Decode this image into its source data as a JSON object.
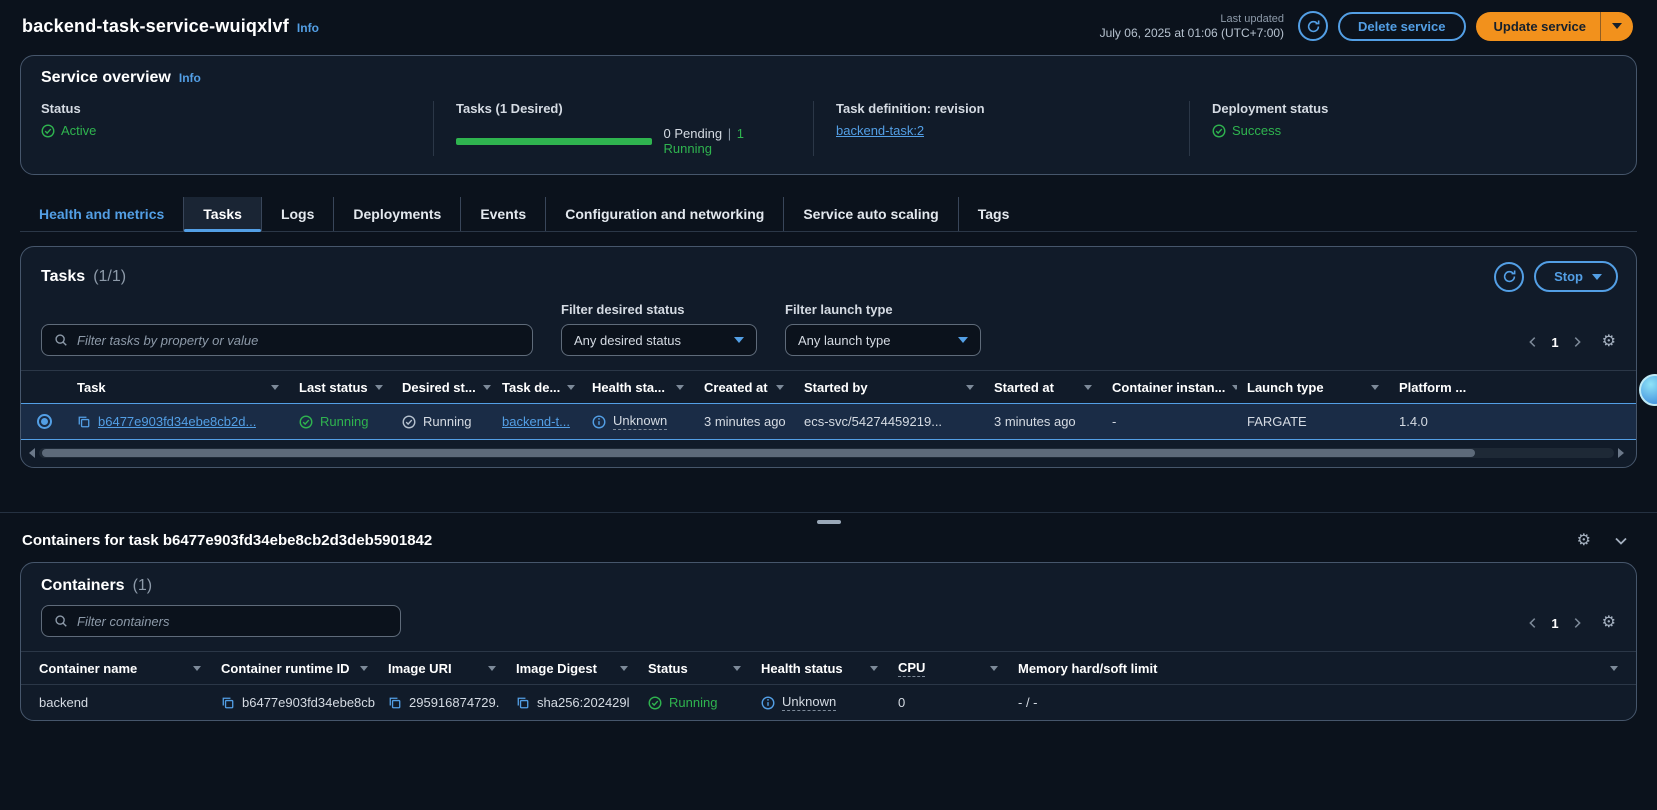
{
  "page": {
    "title": "backend-task-service-wuiqxlvf",
    "info": "Info",
    "last_updated_label": "Last updated",
    "last_updated_value": "July 06, 2025 at 01:06 (UTC+7:00)",
    "delete_service": "Delete service",
    "update_service": "Update service"
  },
  "overview": {
    "title": "Service overview",
    "info": "Info",
    "status": {
      "label": "Status",
      "value": "Active"
    },
    "tasks": {
      "label": "Tasks (1 Desired)",
      "pending": "0 Pending",
      "separator": "|",
      "running": "1 Running",
      "progress_percent": 100
    },
    "task_definition": {
      "label": "Task definition: revision",
      "value": "backend-task:2"
    },
    "deployment": {
      "label": "Deployment status",
      "value": "Success"
    }
  },
  "tabs": [
    {
      "label": "Health and metrics"
    },
    {
      "label": "Tasks"
    },
    {
      "label": "Logs"
    },
    {
      "label": "Deployments"
    },
    {
      "label": "Events"
    },
    {
      "label": "Configuration and networking"
    },
    {
      "label": "Service auto scaling"
    },
    {
      "label": "Tags"
    }
  ],
  "tasks_panel": {
    "title": "Tasks",
    "count": "(1/1)",
    "stop_button": "Stop",
    "filter_placeholder": "Filter tasks by property or value",
    "desired_status_filter": {
      "label": "Filter desired status",
      "value": "Any desired status"
    },
    "launch_type_filter": {
      "label": "Filter launch type",
      "value": "Any launch type"
    },
    "pagination": {
      "page": "1"
    },
    "columns": [
      "Task",
      "Last status",
      "Desired st...",
      "Task de...",
      "Health sta...",
      "Created at",
      "Started by",
      "Started at",
      "Container instan...",
      "Launch type",
      "Platform ..."
    ],
    "row": {
      "task_id": "b6477e903fd34ebe8cb2d...",
      "last_status": "Running",
      "desired_status": "Running",
      "task_definition": "backend-t...",
      "health_status": "Unknown",
      "created_at": "3 minutes ago",
      "started_by": "ecs-svc/54274459219...",
      "started_at": "3 minutes ago",
      "container_instance": "-",
      "launch_type": "FARGATE",
      "platform_version": "1.4.0"
    }
  },
  "containers_section": {
    "title": "Containers for task b6477e903fd34ebe8cb2d3deb5901842"
  },
  "containers_panel": {
    "title": "Containers",
    "count": "(1)",
    "filter_placeholder": "Filter containers",
    "pagination": {
      "page": "1"
    },
    "columns": [
      "Container name",
      "Container runtime ID",
      "Image URI",
      "Image Digest",
      "Status",
      "Health status",
      "CPU",
      "Memory hard/soft limit"
    ],
    "row": {
      "name": "backend",
      "runtime_id": "b6477e903fd34ebe8cb",
      "image_uri": "295916874729.",
      "image_digest": "sha256:202429l",
      "status": "Running",
      "health_status": "Unknown",
      "cpu": "0",
      "memory": "- / -"
    }
  },
  "icons": {
    "gear": "⚙"
  },
  "colors": {
    "primary_button": "#f2911c",
    "link": "#539fe5",
    "success": "#2fb44f",
    "selected_row": "#1a2c46",
    "panel": "#111b29",
    "background": "#0b121c"
  }
}
